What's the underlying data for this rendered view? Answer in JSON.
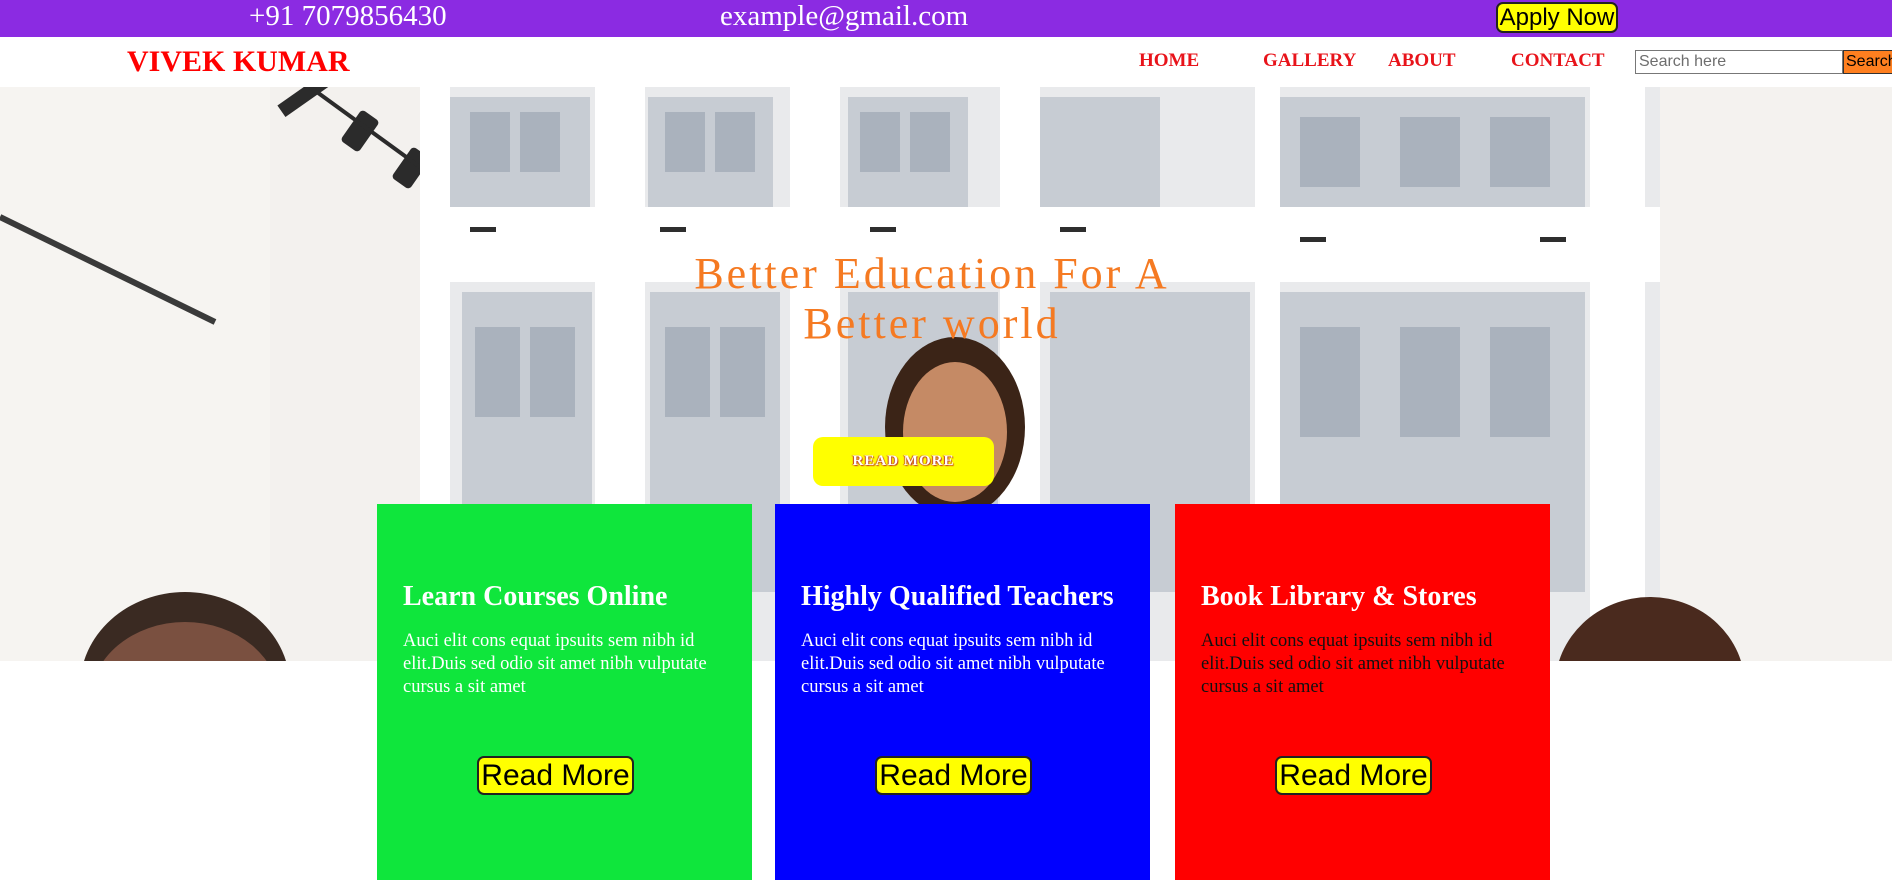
{
  "topbar": {
    "phone": "+91 7079856430",
    "email": "example@gmail.com",
    "apply_label": "Apply Now",
    "background": "#8b2be2"
  },
  "navbar": {
    "logo": "VIVEK KUMAR",
    "items": [
      {
        "label": "HOME"
      },
      {
        "label": "GALLERY"
      },
      {
        "label": "ABOUT"
      },
      {
        "label": "CONTACT"
      }
    ],
    "search_placeholder": "Search here",
    "search_button": "Search",
    "accent": "#e8131a"
  },
  "hero": {
    "title": "Better Education For A Better world",
    "button_label": "READ MORE",
    "title_color": "#f57a22",
    "button_color": "#ffff00"
  },
  "cards": [
    {
      "title": "Learn Courses Online",
      "text": "Auci elit cons equat ipsuits sem nibh id elit.Duis sed odio sit amet nibh vulputate cursus a sit amet",
      "button": "Read More",
      "color": "#0fe63c"
    },
    {
      "title": "Highly Qualified Teachers",
      "text": "Auci elit cons equat ipsuits sem nibh id elit.Duis sed odio sit amet nibh vulputate cursus a sit amet",
      "button": "Read More",
      "color": "#0000ff"
    },
    {
      "title": "Book Library & Stores",
      "text": "Auci elit cons equat ipsuits sem nibh id elit.Duis sed odio sit amet nibh vulputate cursus a sit amet",
      "button": "Read More",
      "color": "#ff0000"
    }
  ]
}
